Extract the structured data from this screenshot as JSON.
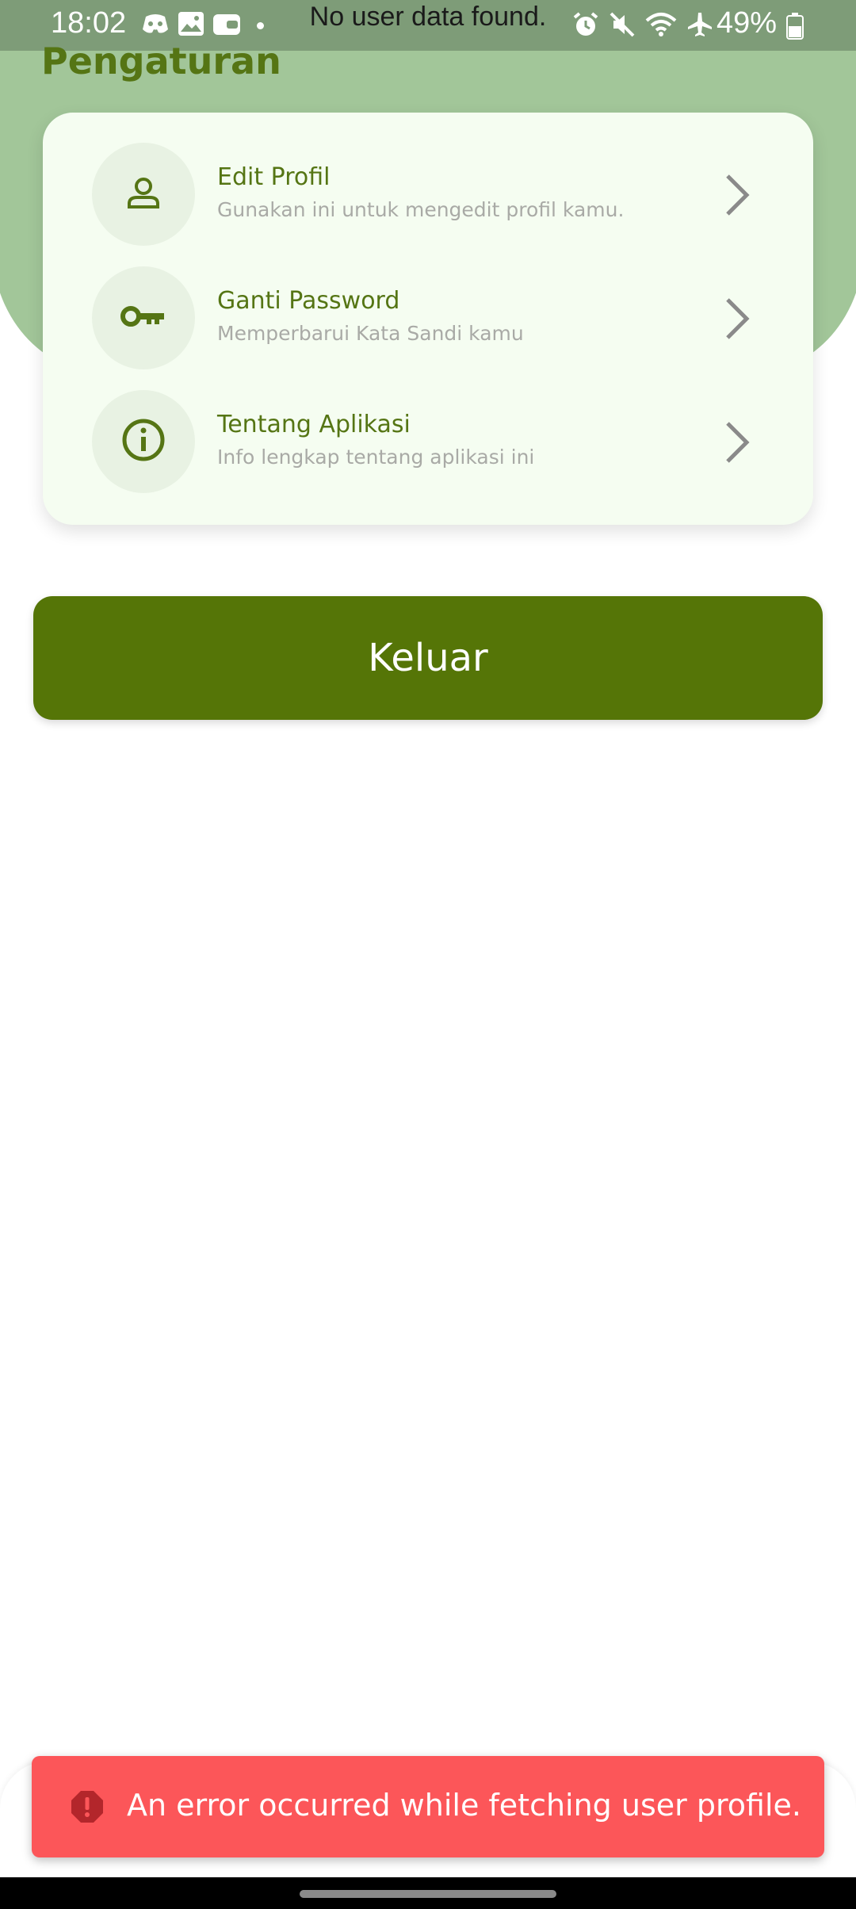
{
  "status_bar": {
    "time": "18:02",
    "battery": "49%",
    "left_icons": [
      "discord-icon",
      "gallery-icon",
      "wallet-icon",
      "dot-icon"
    ],
    "right_icons": [
      "alarm-icon",
      "mute-icon",
      "wifi-icon",
      "airplane-icon",
      "battery-icon"
    ]
  },
  "toast": {
    "message": "No user data found."
  },
  "header": {
    "title": "Pengaturan"
  },
  "settings": {
    "items": [
      {
        "icon": "user-icon",
        "title": "Edit Profil",
        "subtitle": "Gunakan ini untuk mengedit profil kamu."
      },
      {
        "icon": "key-icon",
        "title": "Ganti Password",
        "subtitle": "Memperbarui Kata Sandi kamu"
      },
      {
        "icon": "info-icon",
        "title": "Tentang Aplikasi",
        "subtitle": "Info lengkap tentang aplikasi ini"
      }
    ]
  },
  "logout": {
    "label": "Keluar"
  },
  "snackbar": {
    "message": "An error occurred while fetching user profile.",
    "icon": "error-icon"
  },
  "colors": {
    "primary": "#557507",
    "header_green": "#a2c699",
    "card_bg": "#f5fdf1",
    "error": "#fc5659"
  }
}
